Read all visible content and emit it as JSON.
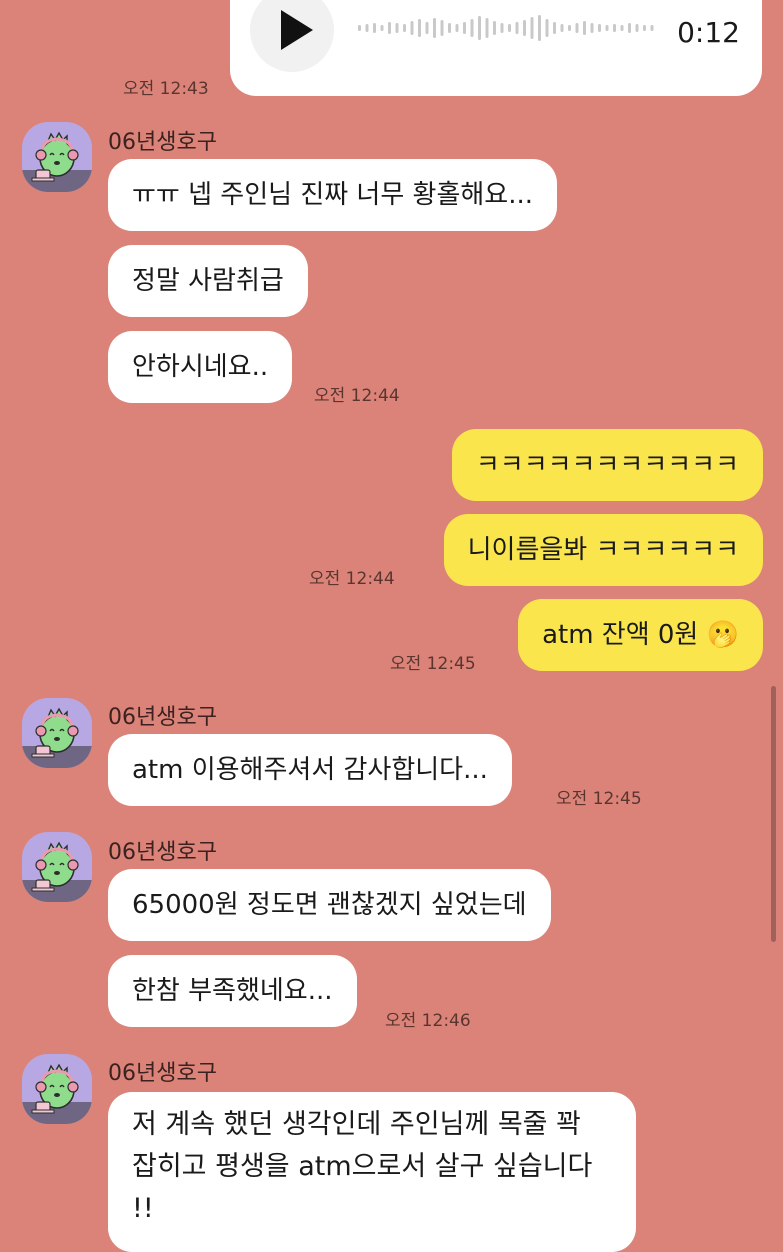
{
  "voice_message": {
    "duration": "0:12",
    "time": "오전 12:43",
    "play_icon": "play-icon"
  },
  "sender_name": "06년생호구",
  "groups": [
    {
      "sender": "06년생호구",
      "messages": [
        "ㅠㅠ 넵 주인님 진짜 너무 황홀해요...",
        "정말 사람취급",
        "안하시네요.."
      ],
      "time": "오전 12:44"
    },
    {
      "outgoing": true,
      "messages": [
        "ㅋㅋㅋㅋㅋㅋㅋㅋㅋㅋㅋ",
        "니이름을봐 ㅋㅋㅋㅋㅋㅋ"
      ],
      "time": "오전 12:44"
    },
    {
      "outgoing": true,
      "messages": [
        "atm 잔액 0원 🫢"
      ],
      "time": "오전 12:45"
    },
    {
      "sender": "06년생호구",
      "messages": [
        "atm 이용해주셔서 감사합니다..."
      ],
      "time": "오전 12:45"
    },
    {
      "sender": "06년생호구",
      "messages": [
        "65000원 정도면 괜찮겠지 싶었는데",
        "한참 부족했네요..."
      ],
      "time": "오전 12:46"
    },
    {
      "sender": "06년생호구",
      "messages": [
        "저 계속 했던 생각인데 주인님께 목줄 꽉 잡히고 평생을 atm으로서 살구 싶습니다 !!"
      ]
    }
  ],
  "colors": {
    "background": "#db8378",
    "incoming_bubble": "#ffffff",
    "outgoing_bubble": "#fbe54d",
    "avatar_bg": "#b7a8e3"
  }
}
